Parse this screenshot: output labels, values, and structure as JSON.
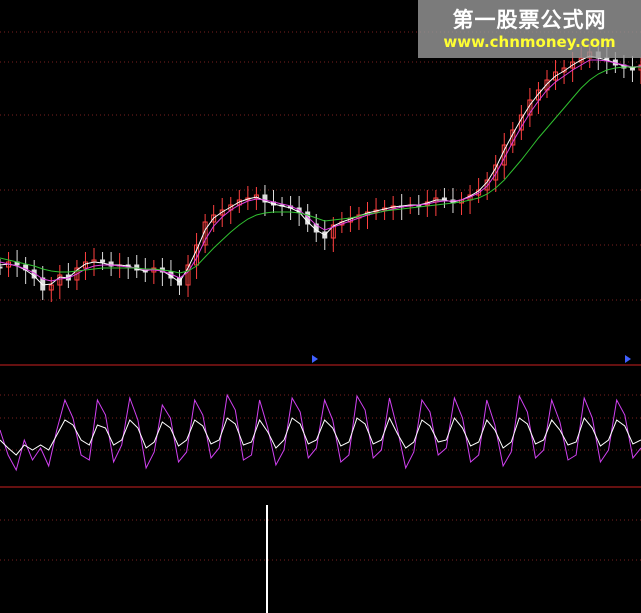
{
  "watermark": {
    "site_name": "第一股票公式网",
    "site_url": "www.chnmoney.com",
    "url_color": "#ffff33"
  },
  "colors": {
    "background": "#000000",
    "grid": "#7a1f1f",
    "divider": "#cc2020",
    "price_up": "#ff4040",
    "price_down": "#dddddd",
    "ma_short": "#ffffff",
    "ma_mid": "#e040e0",
    "ma_long": "#30c030",
    "osc_fast": "#d040f0",
    "osc_slow": "#ffffff",
    "volume_bar": "#ffffff",
    "marker": "#4060ff"
  },
  "chart_data": [
    {
      "type": "candlestick",
      "panel": "price",
      "grid": true,
      "series": [
        {
          "role": "close",
          "values": [
            267,
            262,
            265,
            270,
            278,
            290,
            285,
            275,
            280,
            268,
            262,
            260,
            262,
            266,
            265,
            265,
            270,
            272,
            268,
            272,
            278,
            285,
            265,
            245,
            222,
            215,
            210,
            205,
            200,
            198,
            195,
            202,
            205,
            206,
            208,
            212,
            224,
            232,
            238,
            225,
            222,
            218,
            215,
            212,
            210,
            208,
            206,
            206,
            205,
            205,
            202,
            198,
            200,
            203,
            200,
            195,
            190,
            180,
            165,
            145,
            130,
            115,
            100,
            90,
            80,
            72,
            68,
            62,
            58,
            52,
            58,
            60,
            65,
            68,
            70,
            65
          ]
        },
        {
          "role": "ma_short",
          "values": [
            265,
            264,
            266,
            270,
            276,
            285,
            284,
            277,
            278,
            270,
            264,
            262,
            263,
            265,
            265,
            266,
            269,
            271,
            269,
            271,
            276,
            282,
            268,
            250,
            230,
            218,
            212,
            207,
            202,
            199,
            197,
            201,
            204,
            206,
            208,
            212,
            222,
            230,
            235,
            226,
            222,
            219,
            216,
            213,
            211,
            209,
            207,
            206,
            205,
            205,
            203,
            200,
            200,
            202,
            200,
            196,
            191,
            182,
            168,
            150,
            134,
            119,
            105,
            94,
            84,
            76,
            71,
            65,
            60,
            56,
            58,
            60,
            63,
            66,
            68,
            66
          ]
        },
        {
          "role": "ma_mid",
          "values": [
            262,
            264,
            266,
            269,
            273,
            279,
            281,
            279,
            278,
            274,
            269,
            266,
            265,
            265,
            266,
            267,
            268,
            270,
            270,
            271,
            274,
            278,
            272,
            258,
            240,
            226,
            217,
            210,
            205,
            201,
            199,
            200,
            202,
            204,
            206,
            210,
            217,
            225,
            230,
            227,
            224,
            221,
            218,
            215,
            213,
            211,
            209,
            207,
            206,
            205,
            204,
            202,
            201,
            201,
            200,
            197,
            193,
            186,
            174,
            158,
            142,
            127,
            113,
            101,
            90,
            82,
            76,
            70,
            65,
            60,
            60,
            61,
            63,
            65,
            67,
            66
          ]
        },
        {
          "role": "ma_long",
          "values": [
            258,
            260,
            262,
            264,
            266,
            269,
            271,
            272,
            272,
            271,
            270,
            269,
            268,
            268,
            268,
            268,
            268,
            269,
            269,
            270,
            271,
            273,
            271,
            266,
            257,
            248,
            240,
            232,
            225,
            219,
            215,
            213,
            212,
            212,
            212,
            213,
            215,
            218,
            221,
            220,
            219,
            218,
            216,
            214,
            213,
            211,
            210,
            209,
            208,
            207,
            206,
            205,
            204,
            203,
            202,
            200,
            198,
            194,
            188,
            180,
            170,
            160,
            149,
            138,
            128,
            118,
            108,
            98,
            88,
            80,
            74,
            70,
            68,
            67,
            67,
            67
          ]
        }
      ]
    },
    {
      "type": "line",
      "panel": "oscillator",
      "grid": true,
      "series": [
        {
          "role": "fast",
          "values": [
            430,
            455,
            470,
            440,
            460,
            448,
            466,
            430,
            400,
            418,
            455,
            460,
            400,
            415,
            462,
            445,
            398,
            420,
            468,
            452,
            405,
            418,
            462,
            452,
            400,
            415,
            458,
            448,
            395,
            410,
            460,
            455,
            400,
            428,
            465,
            450,
            398,
            412,
            458,
            448,
            400,
            420,
            462,
            455,
            396,
            410,
            458,
            450,
            398,
            430,
            468,
            452,
            400,
            412,
            455,
            448,
            398,
            418,
            462,
            455,
            400,
            425,
            466,
            452,
            396,
            412,
            458,
            450,
            400,
            422,
            460,
            455,
            398,
            418,
            462,
            450,
            400,
            415,
            458,
            448
          ]
        },
        {
          "role": "slow",
          "values": [
            440,
            448,
            455,
            445,
            450,
            445,
            450,
            435,
            420,
            425,
            440,
            445,
            425,
            428,
            445,
            440,
            420,
            428,
            448,
            442,
            422,
            428,
            446,
            440,
            420,
            426,
            444,
            440,
            418,
            424,
            445,
            442,
            420,
            432,
            448,
            440,
            418,
            424,
            444,
            440,
            420,
            428,
            446,
            442,
            418,
            424,
            444,
            440,
            418,
            434,
            448,
            442,
            420,
            426,
            442,
            440,
            418,
            428,
            446,
            442,
            420,
            430,
            448,
            442,
            418,
            424,
            444,
            440,
            420,
            430,
            445,
            442,
            418,
            428,
            446,
            440,
            420,
            426,
            444,
            440
          ]
        }
      ]
    },
    {
      "type": "bar",
      "panel": "volume",
      "grid": true,
      "series": [
        {
          "role": "volume",
          "values": [
            0,
            0,
            0,
            0,
            0,
            0,
            0,
            0,
            0,
            0,
            0,
            0,
            0,
            0,
            0,
            0,
            0,
            0,
            0,
            0,
            0,
            0,
            0,
            0,
            0,
            0,
            0,
            0,
            0,
            0,
            0,
            0,
            0,
            0,
            0,
            0,
            0,
            0,
            0,
            0,
            0,
            0,
            0,
            0,
            0,
            0,
            0,
            0,
            0,
            0,
            0,
            0,
            0,
            0,
            0,
            0,
            0,
            0,
            0,
            0,
            0,
            0,
            0,
            0,
            0,
            0,
            0,
            0,
            0,
            0,
            0,
            0,
            0,
            0,
            0,
            0,
            0,
            0,
            0,
            0,
            100,
            0,
            0,
            0,
            0,
            0,
            0,
            0,
            0,
            0,
            0,
            0,
            0,
            0,
            0,
            0,
            0,
            0,
            0,
            0,
            0,
            0,
            0,
            0,
            0,
            0,
            0,
            0,
            0,
            0,
            0,
            0,
            0,
            0,
            0,
            0,
            0,
            0,
            0,
            0,
            0,
            0,
            0,
            0,
            0,
            0,
            0,
            0,
            0,
            0,
            0,
            0,
            0,
            0,
            0,
            0,
            0,
            0,
            0,
            0,
            0,
            0,
            0,
            0,
            0,
            0,
            0,
            0,
            0,
            0,
            0,
            0,
            0,
            0,
            0,
            0,
            0,
            0,
            0,
            0,
            0,
            0,
            0,
            0,
            0,
            0,
            0,
            0,
            0,
            0
          ]
        }
      ]
    }
  ]
}
